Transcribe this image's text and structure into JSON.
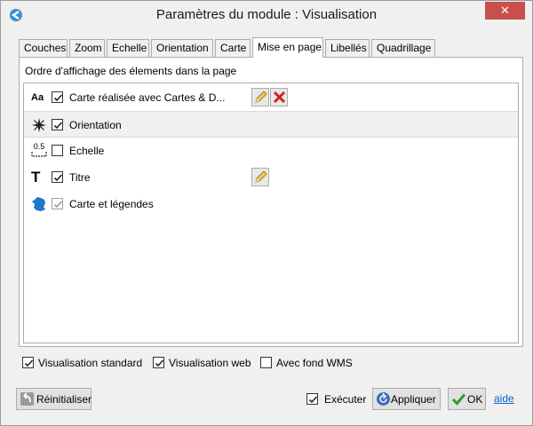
{
  "window": {
    "title": "Paramètres du module : Visualisation",
    "close_label": "✕"
  },
  "tabs": [
    {
      "label": "Couches",
      "active": false
    },
    {
      "label": "Zoom",
      "active": false
    },
    {
      "label": "Echelle",
      "active": false
    },
    {
      "label": "Orientation",
      "active": false
    },
    {
      "label": "Carte",
      "active": false
    },
    {
      "label": "Mise en page",
      "active": true
    },
    {
      "label": "Libellés",
      "active": false
    },
    {
      "label": "Quadrillage",
      "active": false
    }
  ],
  "panel": {
    "heading": "Ordre d'affichage des élements dans la page",
    "items": [
      {
        "label": "Carte réalisée avec Cartes & D...",
        "icon": "text-aa-icon",
        "icon_text": "Aa",
        "checked": true,
        "enabled": true,
        "edit": true,
        "delete": true
      },
      {
        "label": "Orientation",
        "icon": "compass-icon",
        "checked": true,
        "enabled": true,
        "selected": true
      },
      {
        "label": "Echelle",
        "icon": "scale-icon",
        "icon_text": "0.5",
        "checked": false,
        "enabled": true
      },
      {
        "label": "Titre",
        "icon": "title-t-icon",
        "icon_text": "T",
        "checked": true,
        "enabled": true,
        "edit": true
      },
      {
        "label": "Carte et légendes",
        "icon": "map-france-icon",
        "checked": true,
        "enabled": false
      }
    ]
  },
  "options": {
    "standard": {
      "label": "Visualisation standard",
      "checked": true
    },
    "web": {
      "label": "Visualisation web",
      "checked": true
    },
    "wms": {
      "label": "Avec fond WMS",
      "checked": false
    }
  },
  "footer": {
    "reset_label": "Réinitialiser",
    "execute_label": "Exécuter",
    "execute_checked": true,
    "apply_label": "Appliquer",
    "ok_label": "OK",
    "help_label": "aide"
  },
  "colors": {
    "close": "#c7504b",
    "link": "#0066cc",
    "delete_red": "#d42020",
    "ok_green": "#2e9c2e",
    "map_blue": "#1f78c8"
  }
}
